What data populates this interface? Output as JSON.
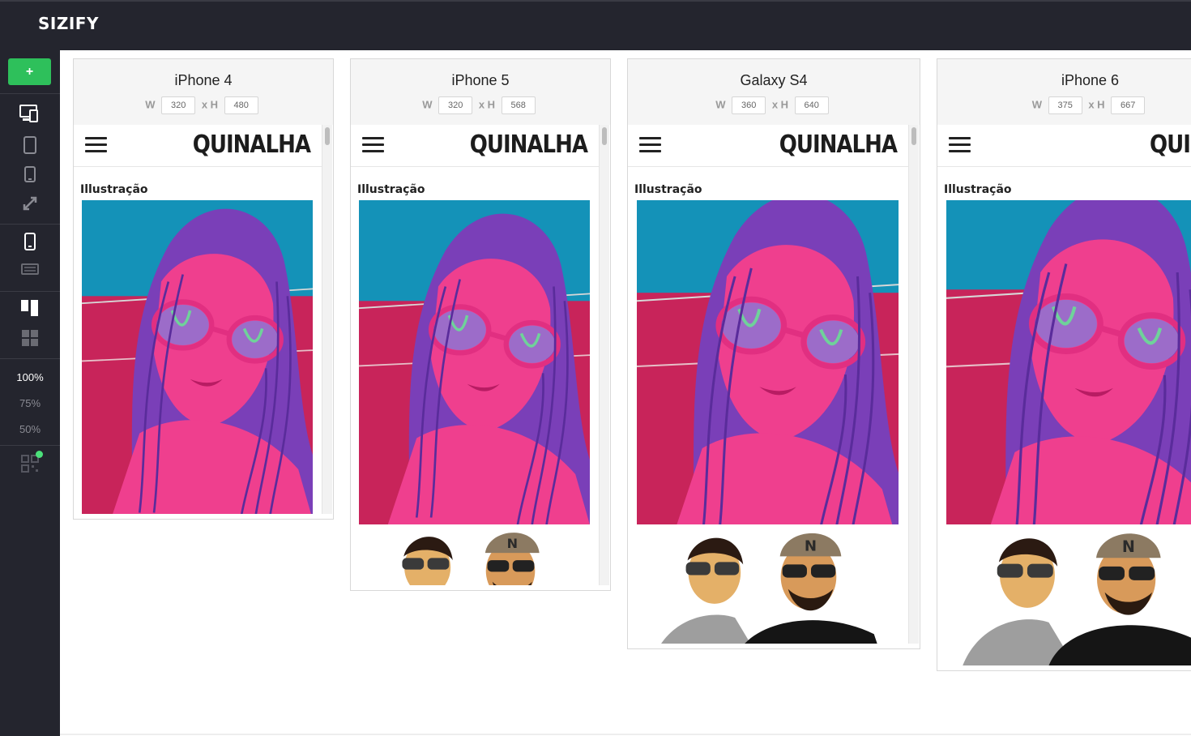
{
  "app": {
    "title": "SIZIFY"
  },
  "sidebar": {
    "add_label": "+",
    "icons": [
      "devices-icon",
      "tablet-icon",
      "phone-icon",
      "expand-icon",
      "portrait-icon",
      "landscape-icon",
      "columns-icon",
      "grid-icon",
      "qr-code-icon"
    ],
    "zoom_levels": [
      "100%",
      "75%",
      "50%"
    ],
    "active_zoom": "100%"
  },
  "devices": [
    {
      "name": "iPhone 4",
      "w_label": "W",
      "h_label": "x H",
      "width": "320",
      "height": "480"
    },
    {
      "name": "iPhone 5",
      "w_label": "W",
      "h_label": "x H",
      "width": "320",
      "height": "568"
    },
    {
      "name": "Galaxy S4",
      "w_label": "W",
      "h_label": "x H",
      "width": "360",
      "height": "640"
    },
    {
      "name": "iPhone 6",
      "w_label": "W",
      "h_label": "x H",
      "width": "375",
      "height": "667"
    }
  ],
  "site": {
    "logo": "QUINALHA",
    "section_label": "Illustração"
  },
  "colors": {
    "accent": "#2ec05b",
    "dark": "#24252e"
  }
}
